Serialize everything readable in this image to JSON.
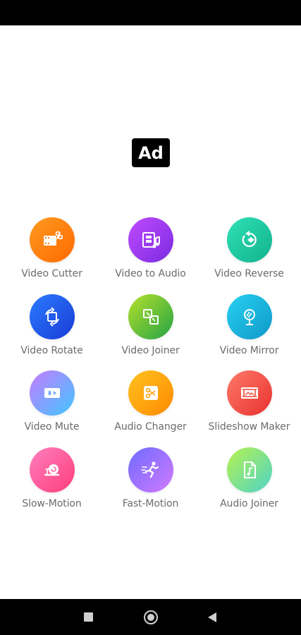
{
  "ad": {
    "label": "Ad"
  },
  "tools": [
    {
      "label": "Video Cutter",
      "icon": "film-scissors-icon",
      "colors": [
        "#ff9a1f",
        "#ff6a00"
      ]
    },
    {
      "label": "Video to Audio",
      "icon": "film-music-icon",
      "colors": [
        "#c04bff",
        "#7a2be0"
      ]
    },
    {
      "label": "Video Reverse",
      "icon": "reverse-icon",
      "colors": [
        "#2fe0b6",
        "#12b28d"
      ]
    },
    {
      "label": "Video Rotate",
      "icon": "rotate-icon",
      "colors": [
        "#2a7bff",
        "#1a3bd6"
      ]
    },
    {
      "label": "Video Joiner",
      "icon": "join-icon",
      "colors": [
        "#b5e02a",
        "#23a446"
      ]
    },
    {
      "label": "Video Mirror",
      "icon": "mirror-icon",
      "colors": [
        "#27d1f0",
        "#0f98c8"
      ]
    },
    {
      "label": "Video Mute",
      "icon": "mute-icon",
      "colors": [
        "#c67bff",
        "#3fc7ff"
      ]
    },
    {
      "label": "Audio Changer",
      "icon": "audio-changer-icon",
      "colors": [
        "#ffc21f",
        "#ff8a00"
      ]
    },
    {
      "label": "Slideshow Maker",
      "icon": "slideshow-icon",
      "colors": [
        "#ff7a6a",
        "#e8312f"
      ]
    },
    {
      "label": "Slow-Motion",
      "icon": "snail-icon",
      "colors": [
        "#ff7fc0",
        "#ff3d7a"
      ]
    },
    {
      "label": "Fast-Motion",
      "icon": "runner-icon",
      "colors": [
        "#6f6bff",
        "#d07aff"
      ]
    },
    {
      "label": "Audio Joiner",
      "icon": "audio-file-icon",
      "colors": [
        "#b6f24f",
        "#4ed3c8"
      ]
    }
  ],
  "nav": {
    "recents": "recents-icon",
    "home": "home-icon",
    "back": "back-icon"
  }
}
